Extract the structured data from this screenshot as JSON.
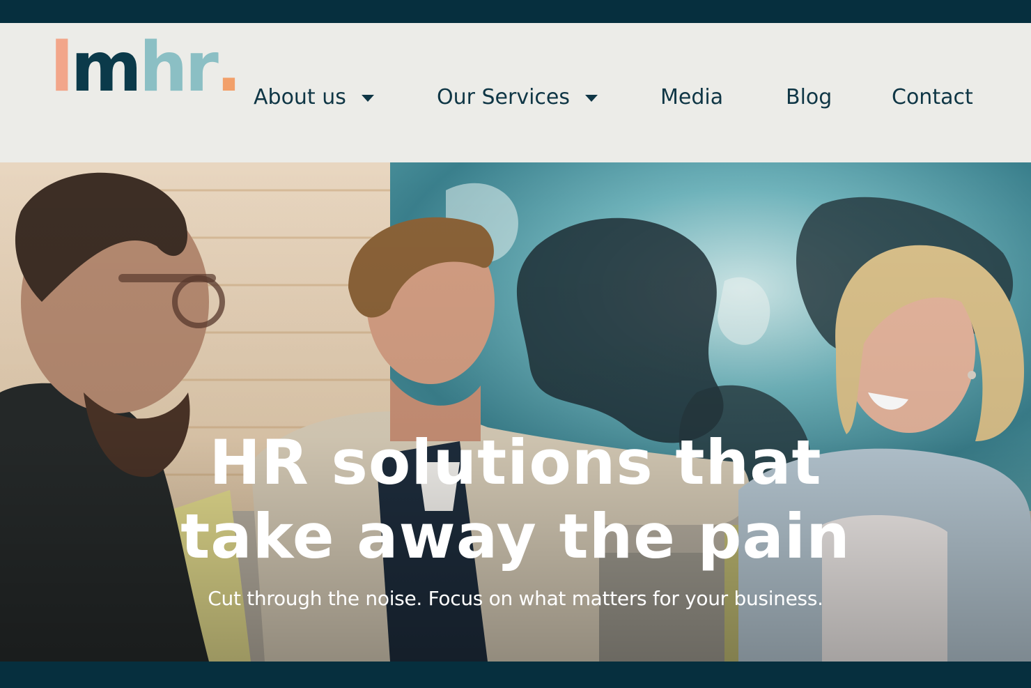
{
  "logo": {
    "letters": [
      "l",
      "m",
      "h",
      "r",
      "."
    ],
    "colors": [
      "#f2a68a",
      "#0b3a4a",
      "#8bbfc4",
      "#8bbfc4",
      "#f2a06a"
    ]
  },
  "nav": {
    "items": [
      {
        "label": "About us",
        "has_dropdown": true
      },
      {
        "label": "Our Services",
        "has_dropdown": true
      },
      {
        "label": "Media",
        "has_dropdown": false
      },
      {
        "label": "Blog",
        "has_dropdown": false
      },
      {
        "label": "Contact",
        "has_dropdown": false
      }
    ]
  },
  "hero": {
    "title_line1": "HR solutions that",
    "title_line2": "take away the pain",
    "subtitle": "Cut through the noise. Focus on what matters for your business."
  },
  "colors": {
    "brand_dark": "#062f3e",
    "nav_text": "#0f3645",
    "header_bg": "#ecece8",
    "accent_peach": "#f2a68a",
    "accent_teal": "#8bbfc4"
  }
}
